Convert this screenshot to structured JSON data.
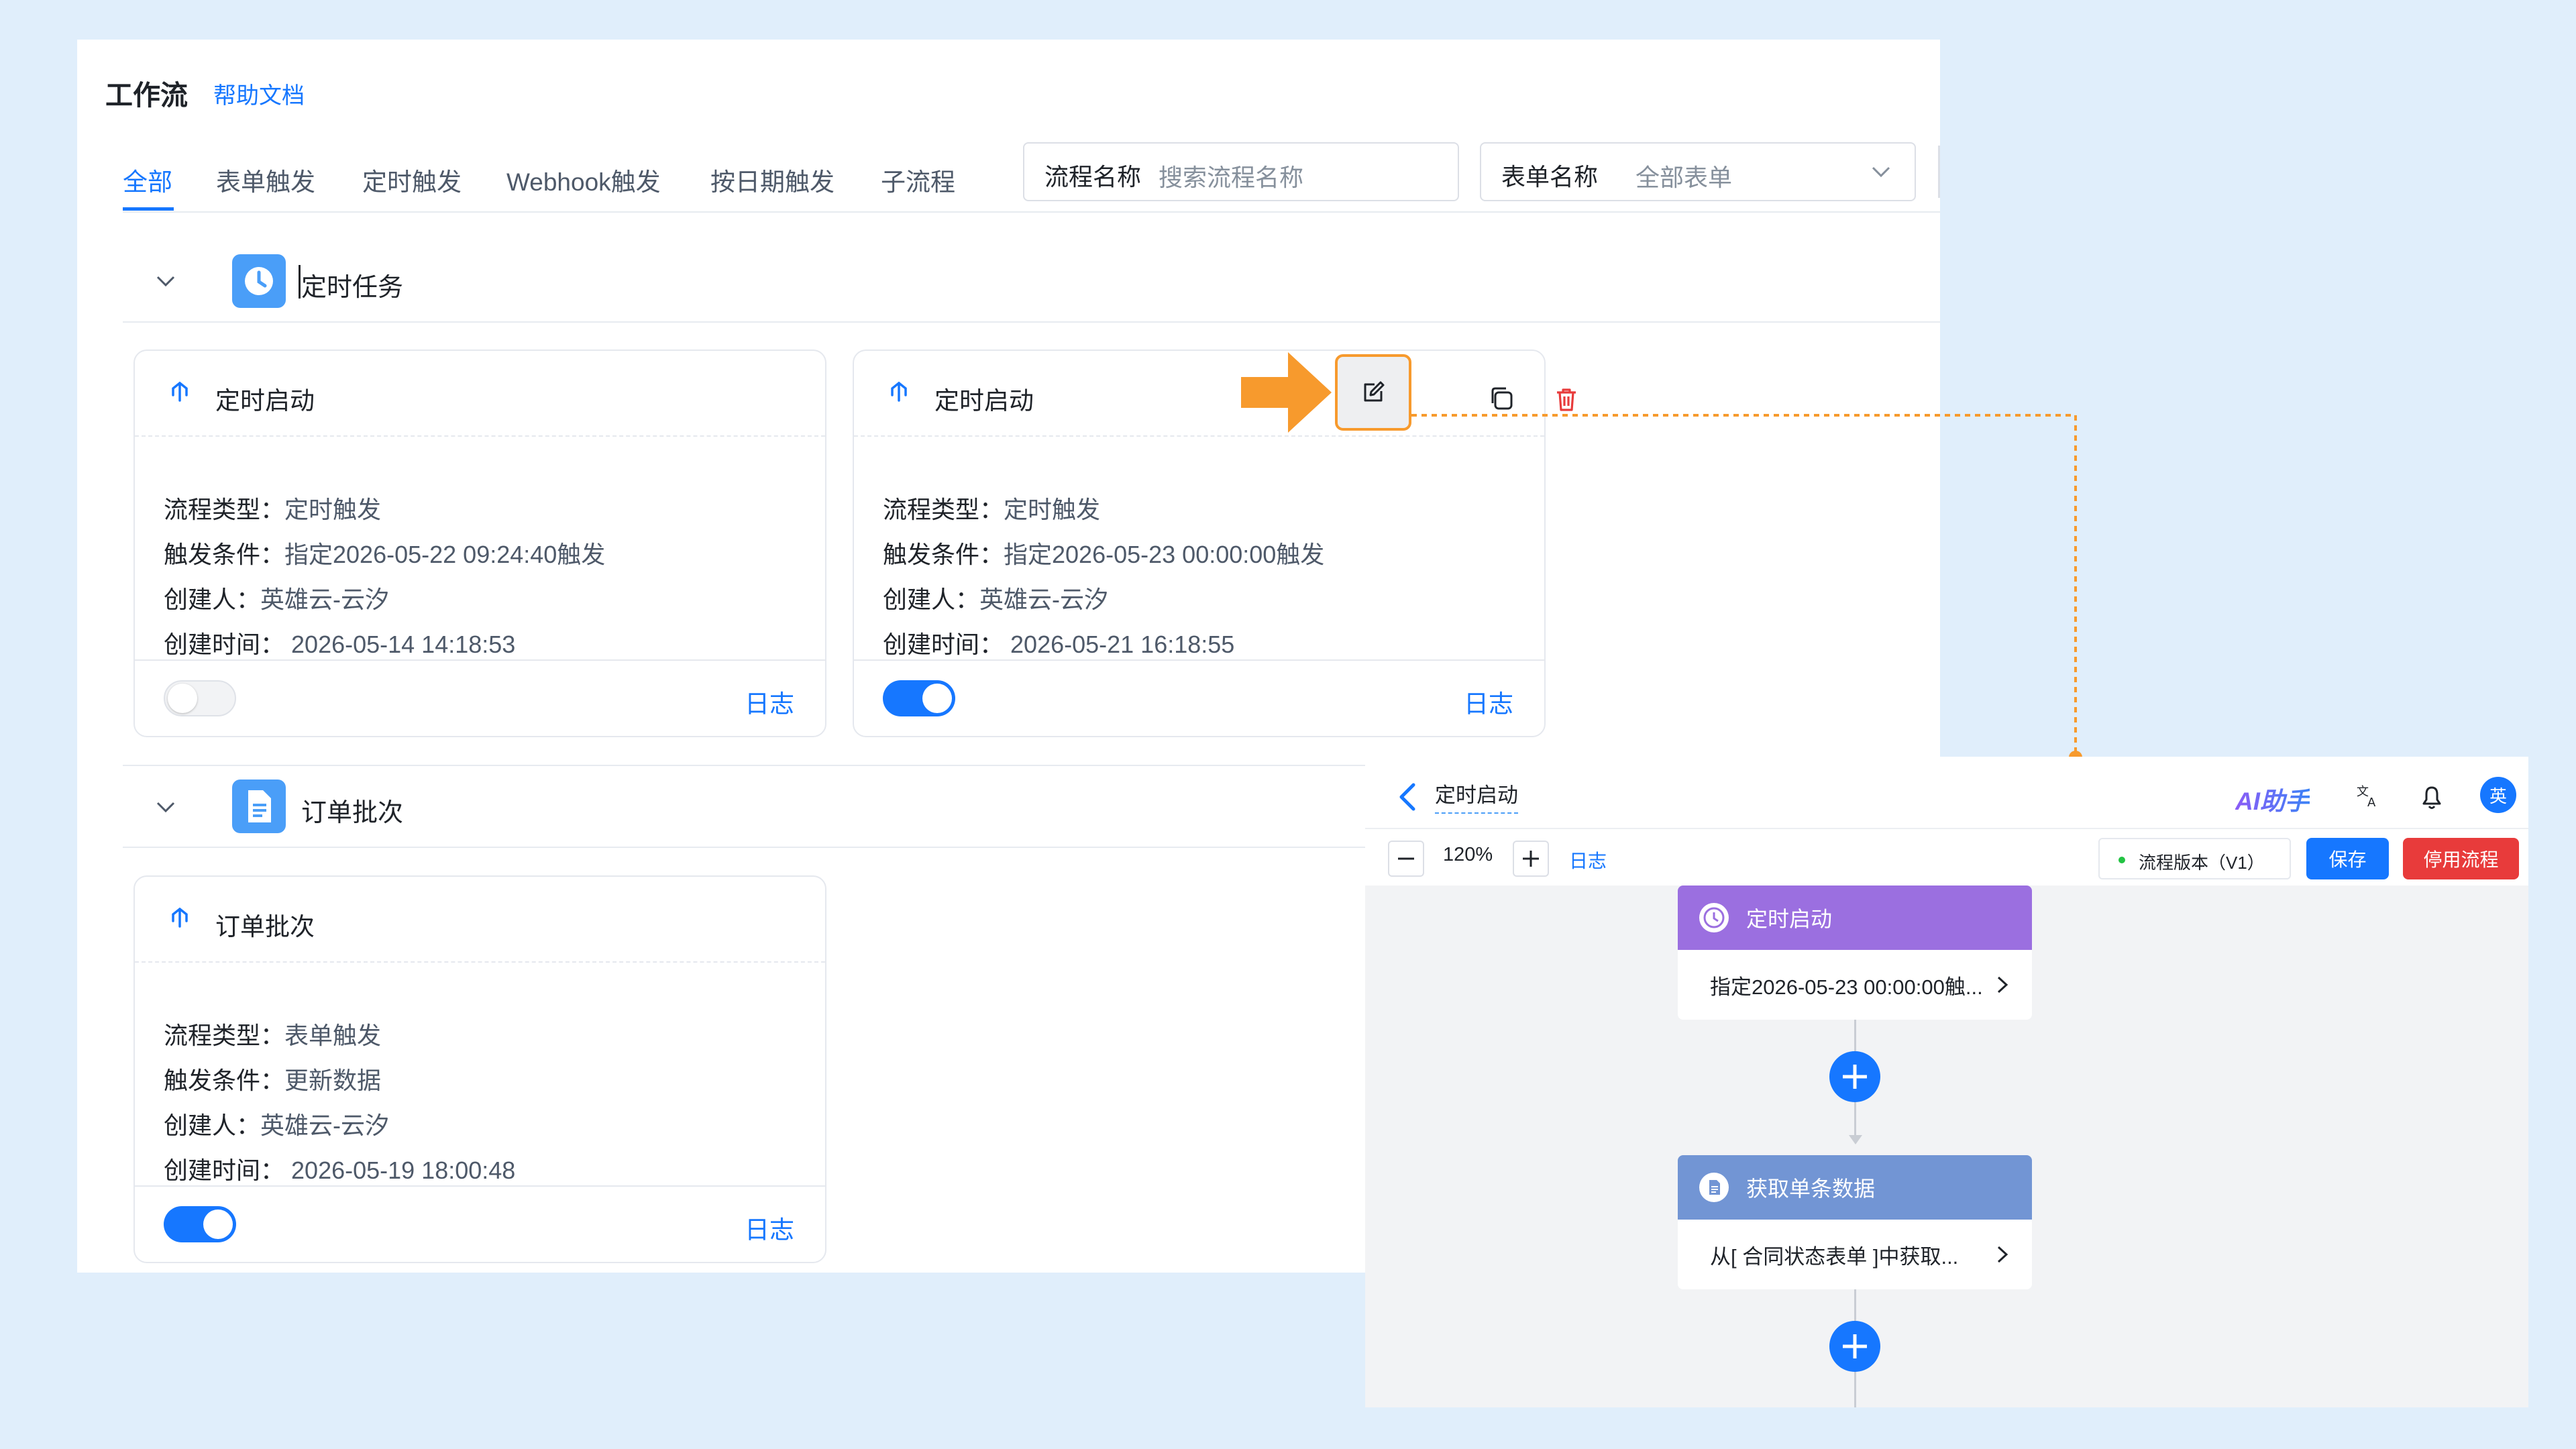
{
  "header": {
    "title": "工作流",
    "help_link": "帮助文档"
  },
  "tabs": [
    "全部",
    "表单触发",
    "定时触发",
    "Webhook触发",
    "按日期触发",
    "子流程"
  ],
  "filters": {
    "flow_name": {
      "label": "流程名称",
      "placeholder": "搜索流程名称"
    },
    "form_name": {
      "label": "表单名称",
      "value": "全部表单"
    }
  },
  "groups": [
    {
      "title": "定时任务",
      "cards": [
        {
          "title": "定时启动",
          "type_label": "流程类型：",
          "type": "定时触发",
          "cond_label": "触发条件：",
          "cond": "指定2026-05-22 09:24:40触发",
          "creator_label": "创建人：",
          "creator": "英雄云-云汐",
          "time_label": "创建时间：",
          "time": "2026-05-14 14:18:53",
          "enabled": false,
          "log": "日志"
        },
        {
          "title": "定时启动",
          "type_label": "流程类型：",
          "type": "定时触发",
          "cond_label": "触发条件：",
          "cond": "指定2026-05-23 00:00:00触发",
          "creator_label": "创建人：",
          "creator": "英雄云-云汐",
          "time_label": "创建时间：",
          "time": "2026-05-21 16:18:55",
          "enabled": true,
          "log": "日志"
        }
      ]
    },
    {
      "title": "订单批次",
      "cards": [
        {
          "title": "订单批次",
          "type_label": "流程类型：",
          "type": "表单触发",
          "cond_label": "触发条件：",
          "cond": "更新数据",
          "creator_label": "创建人：",
          "creator": "英雄云-云汐",
          "time_label": "创建时间：",
          "time": "2026-05-19 18:00:48",
          "enabled": true,
          "log": "日志"
        }
      ]
    }
  ],
  "editor": {
    "title": "定时启动",
    "ai_label": "AI助手",
    "avatar_text": "英",
    "zoom": "120%",
    "log": "日志",
    "version": "流程版本（V1）",
    "save": "保存",
    "stop": "停用流程",
    "nodes": [
      {
        "title": "定时启动",
        "detail": "指定2026-05-23 00:00:00触...",
        "color": "#9b6fe0"
      },
      {
        "title": "获取单条数据",
        "detail": "从[ 合同状态表单 ]中获取...",
        "color": "#7295d4"
      }
    ]
  },
  "colors": {
    "accent": "#1677ff",
    "annotation": "#f79a2d",
    "danger": "#e83b3b"
  }
}
